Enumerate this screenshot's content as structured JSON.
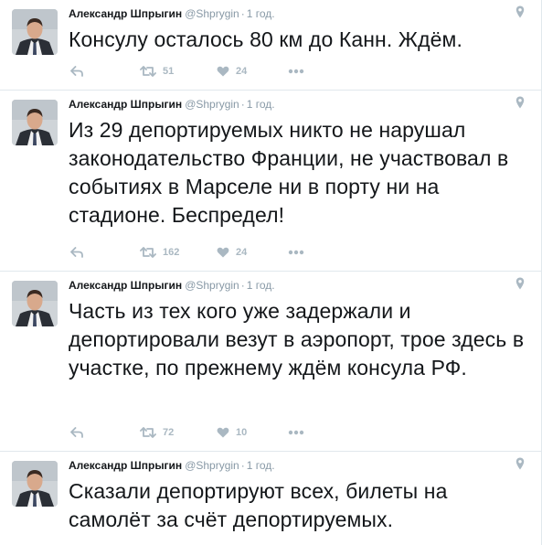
{
  "tweets": [
    {
      "author_name": "Александр Шпрыгин",
      "handle": "@Shprygin",
      "separator": "·",
      "time": "1 год.",
      "text": "Консулу осталось 80 км до Канн. Ждём.",
      "retweets": "51",
      "likes": "24"
    },
    {
      "author_name": "Александр Шпрыгин",
      "handle": "@Shprygin",
      "separator": "·",
      "time": "1 год.",
      "text": "Из 29 депортируемых никто не нарушал законодательство Франции, не участвовал в событиях в Марселе ни в порту ни на стадионе. Беспредел!",
      "retweets": "162",
      "likes": "24"
    },
    {
      "author_name": "Александр Шпрыгин",
      "handle": "@Shprygin",
      "separator": "·",
      "time": "1 год.",
      "text": "Часть из тех кого уже задержали и депортировали везут в аэропорт, трое здесь в участке, по прежнему ждём консула РФ.",
      "retweets": "72",
      "likes": "10"
    },
    {
      "author_name": "Александр Шпрыгин",
      "handle": "@Shprygin",
      "separator": "·",
      "time": "1 год.",
      "text": "Сказали депортируют всех, билеты на самолёт за счёт депортируемых.",
      "retweets": "",
      "likes": ""
    }
  ],
  "icons": {
    "reply": "reply-icon",
    "retweet": "retweet-icon",
    "like": "heart-icon",
    "more": "more-icon",
    "geo": "location-pin-icon"
  },
  "colors": {
    "text": "#14171a",
    "secondary": "#8899a6",
    "action": "#aab8c2",
    "border": "#e1e8ed"
  }
}
